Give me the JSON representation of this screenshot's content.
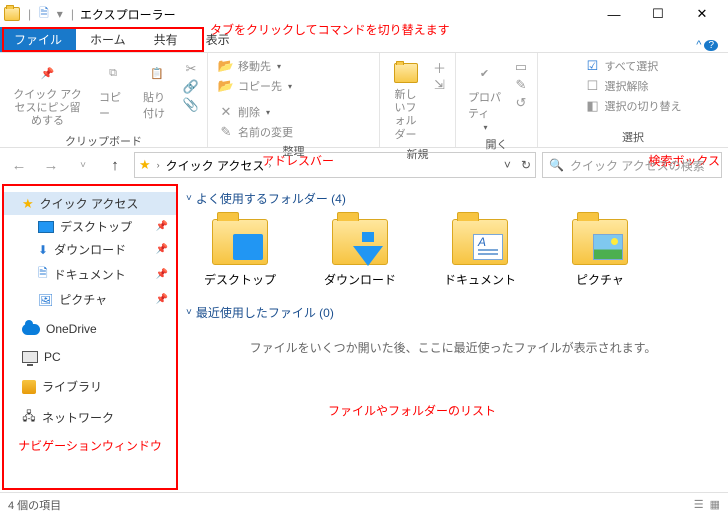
{
  "title": "エクスプローラー",
  "window_controls": {
    "min": "—",
    "max": "☐",
    "close": "✕"
  },
  "tabs": {
    "file": "ファイル",
    "home": "ホーム",
    "share": "共有",
    "view": "表示"
  },
  "ribbon": {
    "clipboard": {
      "pin": "クイック アクセスにピン留めする",
      "copy": "コピー",
      "paste": "貼り付け",
      "label": "クリップボード"
    },
    "organize": {
      "moveto": "移動先",
      "copyto": "コピー先",
      "delete": "削除",
      "rename": "名前の変更",
      "label": "整理"
    },
    "new": {
      "newfolder": "新しいフォルダー",
      "label": "新規"
    },
    "open": {
      "properties": "プロパティ",
      "label": "開く"
    },
    "select": {
      "all": "すべて選択",
      "none": "選択解除",
      "invert": "選択の切り替え",
      "label": "選択"
    }
  },
  "addressbar": {
    "crumb1": "クイック アクセス"
  },
  "search_placeholder": "クイック アクセスの検索",
  "nav": {
    "quick_access": "クイック アクセス",
    "desktop": "デスクトップ",
    "downloads": "ダウンロード",
    "documents": "ドキュメント",
    "pictures": "ピクチャ",
    "onedrive": "OneDrive",
    "pc": "PC",
    "libraries": "ライブラリ",
    "network": "ネットワーク"
  },
  "content": {
    "freq_head": "よく使用するフォルダー (4)",
    "recent_head": "最近使用したファイル (0)",
    "items": {
      "desktop": "デスクトップ",
      "downloads": "ダウンロード",
      "documents": "ドキュメント",
      "pictures": "ピクチャ"
    },
    "empty_msg": "ファイルをいくつか開いた後、ここに最近使ったファイルが表示されます。"
  },
  "status": {
    "count": "4 個の項目"
  },
  "annotations": {
    "tabs": "タブをクリックしてコマンドを切り替えます",
    "addr": "アドレスバー",
    "search": "検索ボックス",
    "navpane": "ナビゲーションウィンドウ",
    "list": "ファイルやフォルダーのリスト"
  }
}
